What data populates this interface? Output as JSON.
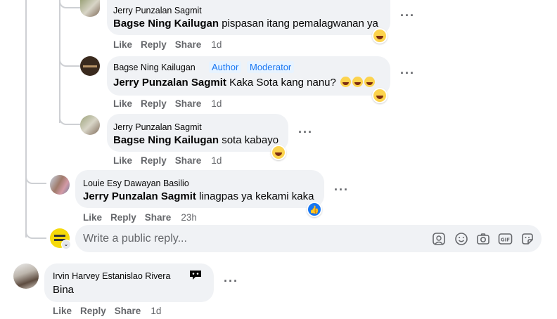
{
  "comments": [
    {
      "author": "Jerry Punzalan Sagmit",
      "mention": "Bagse Ning Kailugan",
      "text": " pispasan itang pemalagwanan ya",
      "actions": [
        "Like",
        "Reply",
        "Share"
      ],
      "time": "1d",
      "reaction": "haha"
    },
    {
      "author": "Bagse Ning Kailugan",
      "badges": [
        "Author",
        "Moderator"
      ],
      "mention": "Jerry Punzalan Sagmit",
      "text": " Kaka Sota kang nanu? ",
      "actions": [
        "Like",
        "Reply",
        "Share"
      ],
      "time": "1d",
      "reaction": "haha"
    },
    {
      "author": "Jerry Punzalan Sagmit",
      "mention": "Bagse Ning Kailugan",
      "text": " sota kabayo",
      "actions": [
        "Like",
        "Reply",
        "Share"
      ],
      "time": "1d",
      "reaction": "haha"
    },
    {
      "author": "Louie Esy Dawayan Basilio",
      "mention": "Jerry Punzalan Sagmit",
      "text": " linagpas ya kekami kaka",
      "actions": [
        "Like",
        "Reply",
        "Share"
      ],
      "time": "23h",
      "reaction": "like"
    },
    {
      "author": "Irvin Harvey Estanislao Rivera",
      "text": "Bina",
      "actions": [
        "Like",
        "Reply",
        "Share"
      ],
      "time": "1d"
    }
  ],
  "reply_box": {
    "placeholder": "Write a public reply..."
  },
  "colors": {
    "bubble": "#f0f2f5",
    "badge_bg": "#e7f3ff",
    "badge_text": "#1876f2",
    "meta": "#65676b"
  }
}
